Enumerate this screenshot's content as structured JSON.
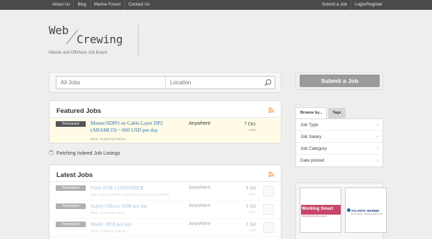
{
  "topbar": {
    "left_links": [
      "About Us",
      "Blog",
      "Marine Forum",
      "Contact Us"
    ],
    "right_links": [
      "Submit a Job",
      "Login/Register"
    ]
  },
  "logo": {
    "word1": "Web",
    "word2": "Crewing",
    "tagline": "Marine and Offshore Job Board"
  },
  "search": {
    "jobs_placeholder": "All Jobs",
    "location_placeholder": "Location"
  },
  "submit_button": "Submit a Job",
  "featured": {
    "title": "Featured Jobs",
    "job": {
      "badge": "Permanent",
      "title": "Master/SDPO on Cable Layer DP2 (ARAMCO) ~ 600 USD per day",
      "meta": "BCM - Posted by Marcia",
      "location": "Anywhere",
      "date": "7 Oct",
      "year": "2020"
    }
  },
  "fetching_text": "Fetching Indeed Job Listings",
  "latest": {
    "title": "Latest Jobs",
    "jobs": [
      {
        "badge": "Permanent",
        "title": "Fitter FOR CONTAINER",
        "meta": "SAS CREW MARINE - Posted by SAS CREW MARINE",
        "location": "Anywhere",
        "date": "9 Jul",
        "year": "2020"
      },
      {
        "badge": "Permanent",
        "title": "Safety Officer 350$ per day",
        "meta": "BCM - Posted by Marcia",
        "location": "Anywhere",
        "date": "3 Jul",
        "year": "2020"
      },
      {
        "badge": "Permanent",
        "title": "Medic 305$ per day",
        "meta": "BCM - Posted by Marcia",
        "location": "Anywhere",
        "date": "3 Jul",
        "year": "2020"
      }
    ]
  },
  "browse": {
    "tab_active": "Browse by...",
    "tab_inactive": "Tags",
    "items": [
      "Job Type",
      "Job Salary",
      "Job Category",
      "Date posted"
    ]
  },
  "ads": {
    "ad1": {
      "name": "Working Smart",
      "sub": "Global Precision Recruitment"
    },
    "ad2": {
      "name": "ATLANTIC MARINE",
      "sub": "OFFSHORE & MARINE SERVICES"
    }
  },
  "colors": {
    "link": "#2a6db0",
    "topbar": "#4a4a4a",
    "featured_row": "#fffbe6",
    "rss": "#f07d1a"
  }
}
